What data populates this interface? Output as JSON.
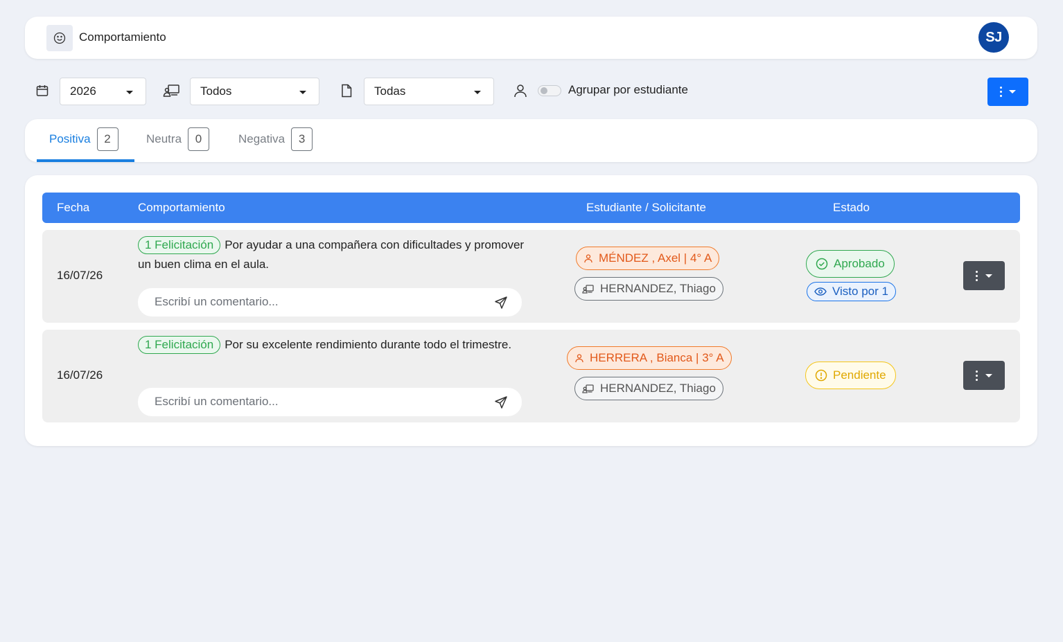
{
  "header": {
    "title": "Comportamiento",
    "avatar_initials": "SJ"
  },
  "filters": {
    "year": "2026",
    "course": "Todos",
    "type": "Todas",
    "group_by_student_label": "Agrupar por estudiante",
    "group_by_student_on": false
  },
  "tabs": [
    {
      "label": "Positiva",
      "count": "2",
      "active": true
    },
    {
      "label": "Neutra",
      "count": "0",
      "active": false
    },
    {
      "label": "Negativa",
      "count": "3",
      "active": false
    }
  ],
  "table": {
    "headers": {
      "date": "Fecha",
      "behavior": "Comportamiento",
      "student": "Estudiante / Solicitante",
      "status": "Estado"
    },
    "comment_placeholder": "Escribí un comentario...",
    "rows": [
      {
        "date": "16/07/26",
        "tag": "1 Felicitación",
        "description": "Por ayudar a una compañera con dificultades y promover un buen clima en el aula.",
        "student": "MÉNDEZ , Axel | 4° A",
        "requester": "HERNANDEZ, Thiago",
        "status": "Aprobado",
        "seen": "Visto por 1"
      },
      {
        "date": "16/07/26",
        "tag": "1 Felicitación",
        "description": "Por su excelente rendimiento durante todo el trimestre.",
        "student": "HERRERA , Bianca | 3° A",
        "requester": "HERNANDEZ, Thiago",
        "status": "Pendiente"
      }
    ]
  },
  "colors": {
    "primary": "#0d6efd",
    "table_header": "#3b82f0",
    "tab_active": "#1a7fe0",
    "avatar": "#0d47a1"
  }
}
